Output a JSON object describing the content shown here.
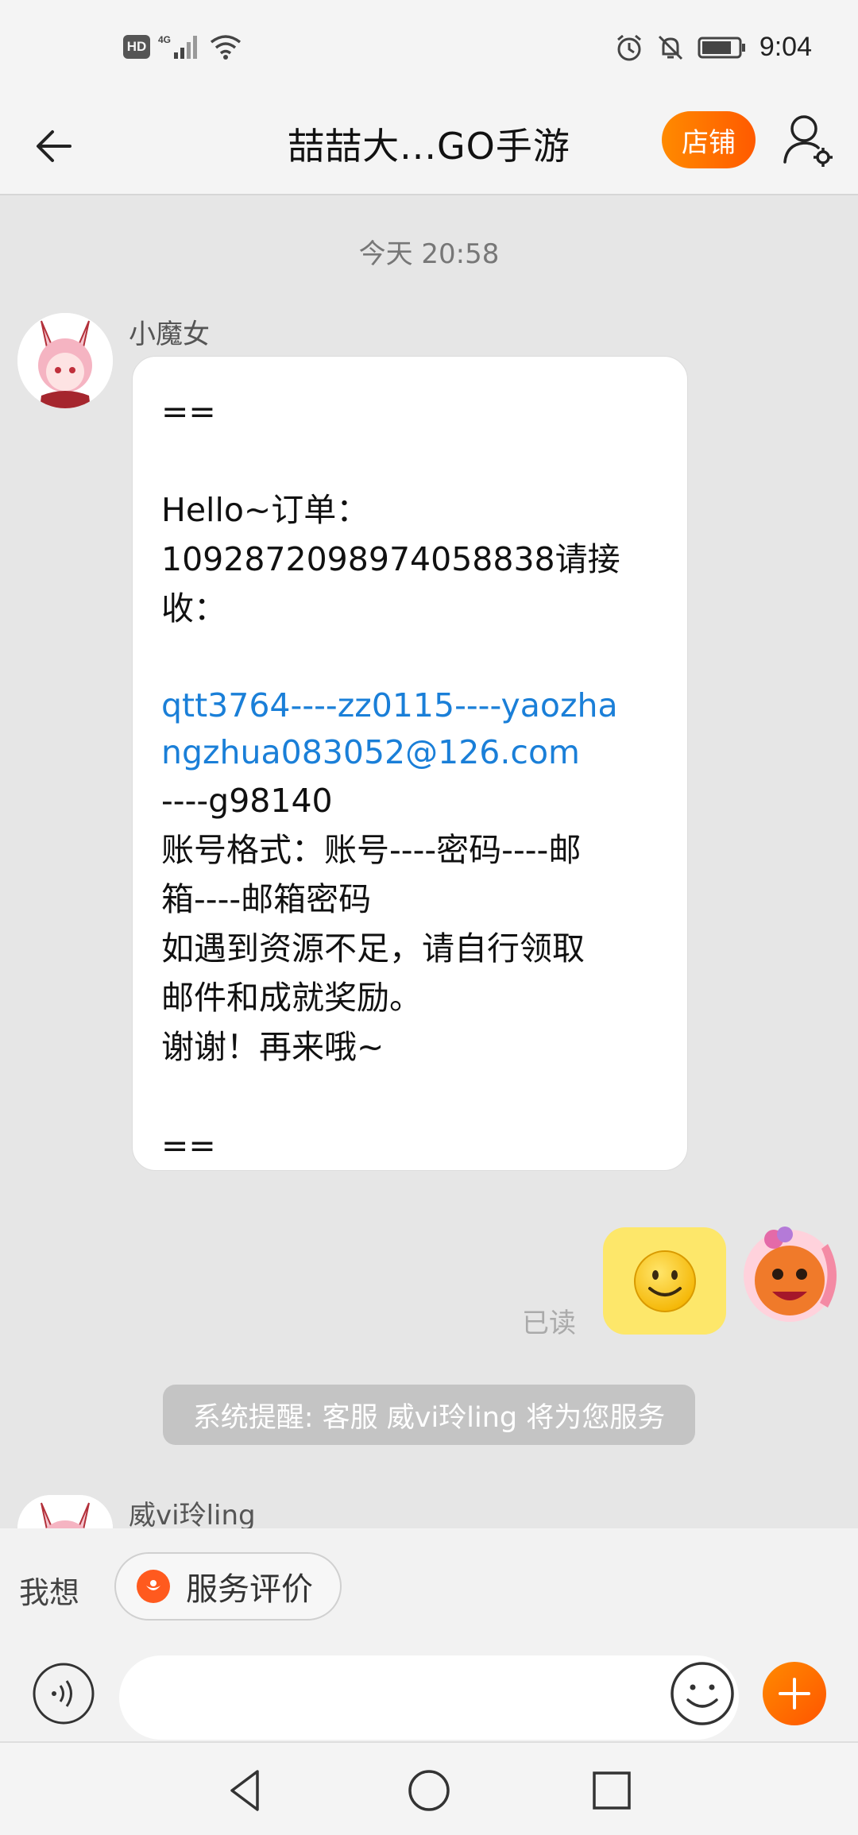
{
  "status_bar": {
    "hd_label": "HD",
    "network_label": "4G",
    "time": "9:04",
    "icons": [
      "hd-icon",
      "signal-icon",
      "wifi-icon",
      "alarm-icon",
      "mute-icon",
      "battery-icon"
    ]
  },
  "header": {
    "title": "喆喆大...GO手游",
    "shop_label": "店铺",
    "back_icon": "back-arrow-icon",
    "profile_icon": "user-settings-icon",
    "accent_color": "#ff6a00"
  },
  "chat": {
    "timestamp": "今天  20:58",
    "message_1": {
      "sender": "小魔女",
      "lines": [
        "==",
        "",
        "Hello~订单：",
        "1092872098974058838请接",
        "收：",
        "",
        "qtt3764----zz0115----yaozha",
        "ngzhua083052@126.com",
        "----g98140",
        "账号格式：账号----密码----邮",
        "箱----邮箱密码",
        "如遇到资源不足，请自行领取",
        "邮件和成就奖励。",
        "谢谢！再来哦~",
        "",
        "=="
      ],
      "link_color": "#1a7fd8"
    },
    "my_message": {
      "read_label": "已读",
      "emoji": "🙂"
    },
    "system_tip": "系统提醒: 客服 威vi玲ling 将为您服务",
    "message_2": {
      "sender": "威vi玲ling"
    }
  },
  "quick_bar": {
    "label": "我想",
    "chip_label": "服务评价"
  },
  "input_bar": {
    "placeholder": "",
    "voice_icon": "voice-icon",
    "emoji_icon": "emoji-icon",
    "plus_icon": "plus-icon"
  },
  "nav_bar": {
    "icons": [
      "nav-back-icon",
      "nav-home-icon",
      "nav-recents-icon"
    ]
  }
}
